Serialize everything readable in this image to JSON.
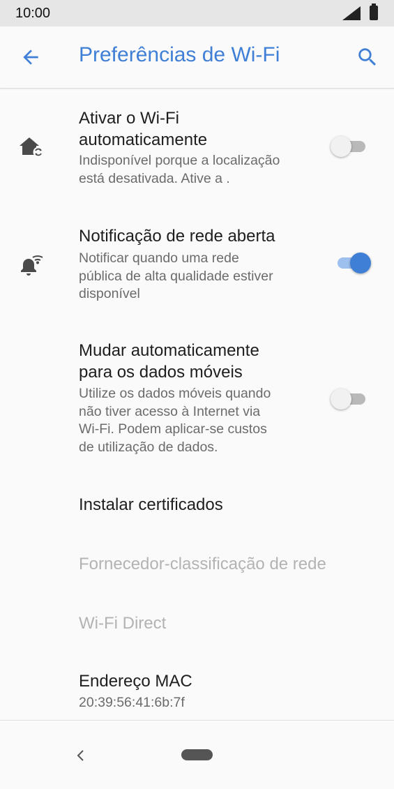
{
  "status_bar": {
    "time": "10:00",
    "icons": [
      "signal-icon",
      "battery-icon"
    ]
  },
  "app_bar": {
    "title": "Preferências de Wi-Fi",
    "icons": [
      "arrow-back-icon",
      "search-icon"
    ]
  },
  "settings": [
    {
      "title_lines": [
        "Ativar o Wi-Fi",
        "automaticamente"
      ],
      "summary_lines": [
        "Indisponível porque a localização",
        "está desativada. Ative a ."
      ],
      "icon": "home-sync-icon",
      "toggle": "off"
    },
    {
      "title_lines": [
        "Notificação de rede aberta"
      ],
      "summary_lines": [
        "Notificar quando uma rede",
        "pública de alta qualidade estiver",
        "disponível"
      ],
      "icon": "bell-wifi-icon",
      "toggle": "on"
    },
    {
      "title_lines": [
        "Mudar automaticamente",
        "para os dados móveis"
      ],
      "summary_lines": [
        "Utilize os dados móveis quando",
        "não tiver acesso à Internet via",
        "Wi-Fi. Podem aplicar-se custos",
        "de utilização de dados."
      ],
      "toggle": "off"
    },
    {
      "title": "Instalar certificados"
    },
    {
      "title": "Fornecedor-classificação de rede",
      "disabled": true
    },
    {
      "title": "Wi-Fi Direct",
      "disabled": true
    },
    {
      "title": "Endereço MAC",
      "summary": "20:39:56:41:6b:7f"
    }
  ],
  "nav_bar": {
    "icons": [
      "back-nav-icon",
      "home-pill"
    ]
  },
  "colors": {
    "accent": "#3f7fd6",
    "status_bar_bg": "#e6e6e6",
    "background": "#fafafa"
  }
}
